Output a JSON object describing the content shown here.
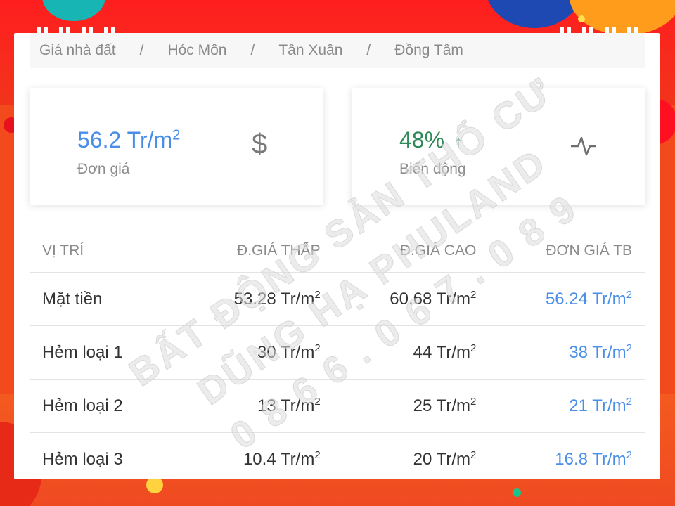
{
  "breadcrumb": [
    "Giá nhà đất",
    "Hóc Môn",
    "Tân Xuân",
    "Đồng Tâm"
  ],
  "breadcrumb_separator": "/",
  "stats": {
    "price": {
      "value": "56.2 Tr/m",
      "sup": "2",
      "label": "Đơn giá",
      "icon": "dollar-icon",
      "icon_glyph": "$"
    },
    "change": {
      "value": "48%",
      "arrow": "↑",
      "label": "Biến động",
      "icon": "pulse-icon"
    }
  },
  "table": {
    "headers": [
      "VỊ TRÍ",
      "Đ.GIÁ THẤP",
      "Đ.GIÁ CAO",
      "ĐƠN GIÁ TB"
    ],
    "rows": [
      {
        "location": "Mặt tiền",
        "low": "53.28 Tr/m",
        "high": "60.68 Tr/m",
        "avg": "56.24 Tr/m"
      },
      {
        "location": "Hẻm loại 1",
        "low": "30 Tr/m",
        "high": "44 Tr/m",
        "avg": "38 Tr/m"
      },
      {
        "location": "Hẻm loại 2",
        "low": "13 Tr/m",
        "high": "25 Tr/m",
        "avg": "21 Tr/m"
      },
      {
        "location": "Hẻm loại 3",
        "low": "10.4 Tr/m",
        "high": "20 Tr/m",
        "avg": "16.8 Tr/m"
      }
    ],
    "unit_sup": "2"
  },
  "watermark": [
    "BẤT ĐỘNG SẢN THỔ CƯ",
    "DŨNG HẠ PHULAND",
    "0 8 6 6 . 0 6 7 . 0 8 9"
  ],
  "colors": {
    "accent": "#4a8ee8",
    "positive": "#2e8b57",
    "background": "#f24a1c"
  }
}
